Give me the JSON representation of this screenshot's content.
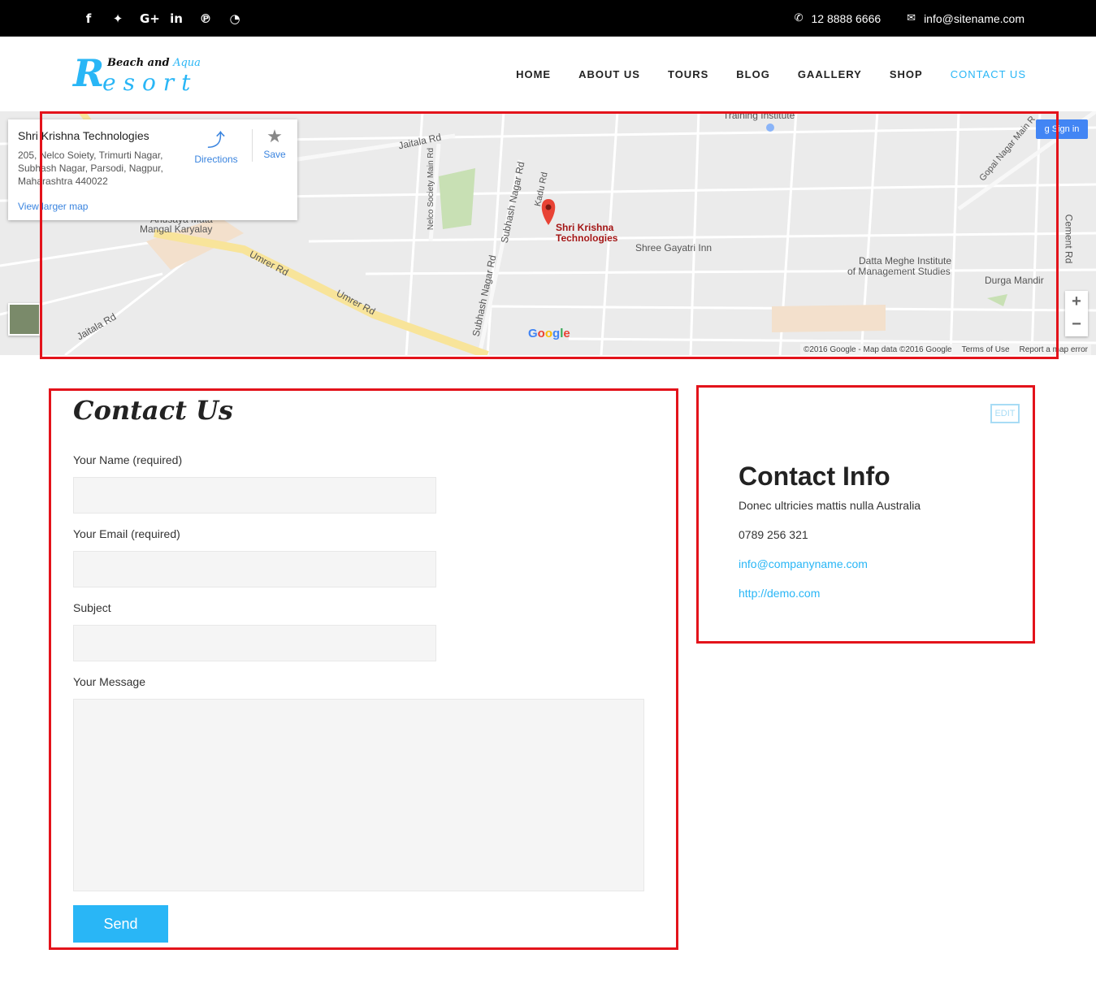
{
  "topbar": {
    "social": [
      {
        "name": "facebook-icon",
        "glyph": "f"
      },
      {
        "name": "twitter-icon",
        "glyph": "🐦"
      },
      {
        "name": "google-plus-icon",
        "glyph": "G+"
      },
      {
        "name": "linkedin-icon",
        "glyph": "in"
      },
      {
        "name": "pinterest-icon",
        "glyph": "℗"
      },
      {
        "name": "rss-icon",
        "glyph": "◔"
      }
    ],
    "phone": "12 8888 6666",
    "email": "info@sitename.com"
  },
  "logo": {
    "line1": "Beach and",
    "line1_accent": "Aqua",
    "initial": "R",
    "rest": "esort"
  },
  "nav": {
    "items": [
      "HOME",
      "ABOUT US",
      "TOURS",
      "BLOG",
      "GAALLERY",
      "SHOP",
      "CONTACT US"
    ],
    "active": "CONTACT US"
  },
  "map": {
    "place_title": "Shri Krishna Technologies",
    "address": "205, Nelco Soiety, Trimurti Nagar, Subhash Nagar, Parsodi, Nagpur, Maharashtra 440022",
    "directions": "Directions",
    "save": "Save",
    "larger_map": "View larger map",
    "sign_in": "Sign in",
    "pin_label_1": "Shri Krishna",
    "pin_label_2": "Technologies",
    "labels": {
      "training": "Training Institute",
      "jaitala_top": "Jaitala Rd",
      "nelco": "Nelco Society Main Rd",
      "subhash_top": "Subhash Nagar Rd",
      "kadu": "Kadu Rd",
      "anusaya": "Anusaya Mata",
      "mangal": "Mangal Karyalay",
      "umrer1": "Umrer Rd",
      "umrer2": "Umrer Rd",
      "subhash_bottom": "Subhash Nagar Rd",
      "jaitala_bottom": "Jaitala Rd",
      "gayatri": "Shree Gayatri Inn",
      "datta1": "Datta Meghe Institute",
      "datta2": "of Management Studies",
      "durga": "Durga Mandir",
      "gopal": "Gopal Nagar Main R",
      "cement": "Cement Rd"
    },
    "google": "Google",
    "attribution": [
      "©2016 Google - Map data ©2016 Google",
      "Terms of Use",
      "Report a map error"
    ],
    "zoom_in": "+",
    "zoom_out": "−"
  },
  "form": {
    "title": "Contact Us",
    "name_label": "Your Name (required)",
    "email_label": "Your Email (required)",
    "subject_label": "Subject",
    "message_label": "Your Message",
    "send_label": "Send"
  },
  "info": {
    "edit": "EDIT",
    "title": "Contact Info",
    "address": "Donec ultricies mattis nulla Australia",
    "phone": "0789 256 321",
    "email": "info@companyname.com",
    "website": "http://demo.com"
  },
  "colors": {
    "accent": "#29b6f6",
    "highlight_outline": "#e3131b",
    "topbar": "#000000"
  }
}
